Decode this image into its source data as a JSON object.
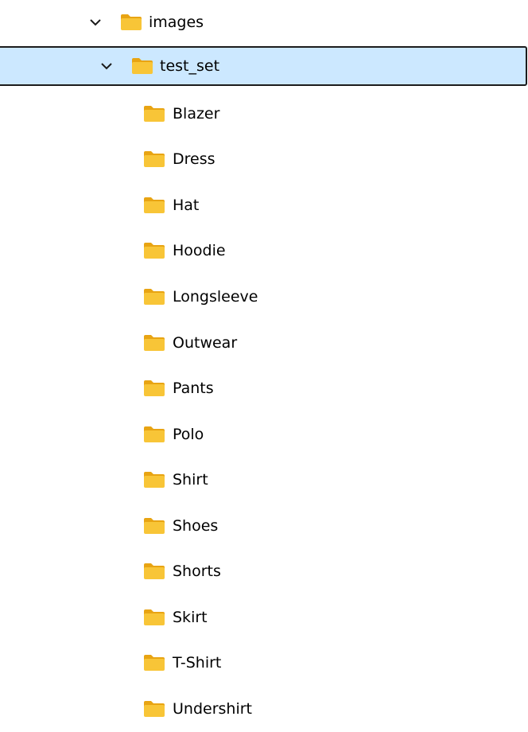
{
  "tree": {
    "root": {
      "label": "images",
      "expanded": true,
      "icon": "folder-icon",
      "children": [
        {
          "label": "test_set",
          "expanded": true,
          "selected": true,
          "icon": "folder-icon",
          "children": [
            {
              "label": "Blazer"
            },
            {
              "label": "Dress"
            },
            {
              "label": "Hat"
            },
            {
              "label": "Hoodie"
            },
            {
              "label": "Longsleeve"
            },
            {
              "label": "Outwear"
            },
            {
              "label": "Pants"
            },
            {
              "label": "Polo"
            },
            {
              "label": "Shirt"
            },
            {
              "label": "Shoes"
            },
            {
              "label": "Shorts"
            },
            {
              "label": "Skirt"
            },
            {
              "label": "T-Shirt"
            },
            {
              "label": "Undershirt"
            }
          ]
        }
      ]
    }
  },
  "colors": {
    "selection_background": "#cce8ff",
    "selection_border": "#1c1c1c",
    "folder_body": "#f8c537",
    "folder_tab": "#e8a413"
  }
}
